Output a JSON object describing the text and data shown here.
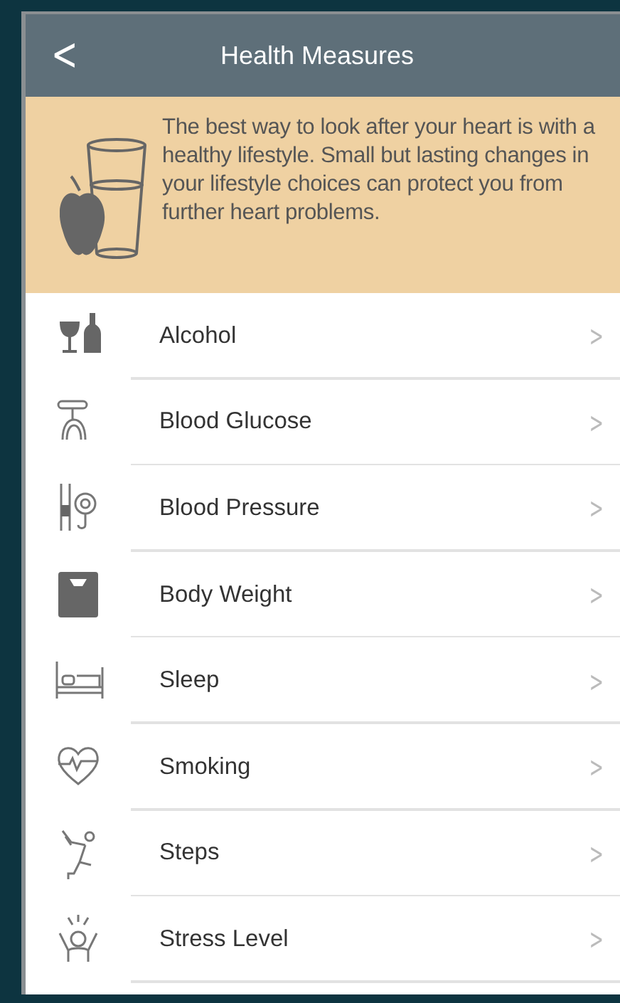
{
  "header": {
    "back": "<",
    "title": "Health Measures"
  },
  "banner": {
    "text": "The best way to look after your heart is with a healthy lifestyle. Small but lasting changes in your lifestyle choices can protect you from further heart problems."
  },
  "items": [
    {
      "label": "Alcohol",
      "chevron": ">"
    },
    {
      "label": "Blood Glucose",
      "chevron": ">"
    },
    {
      "label": "Blood Pressure",
      "chevron": ">"
    },
    {
      "label": "Body Weight",
      "chevron": ">"
    },
    {
      "label": "Sleep",
      "chevron": ">"
    },
    {
      "label": "Smoking",
      "chevron": ">"
    },
    {
      "label": "Steps",
      "chevron": ">"
    },
    {
      "label": "Stress Level",
      "chevron": ">"
    }
  ]
}
